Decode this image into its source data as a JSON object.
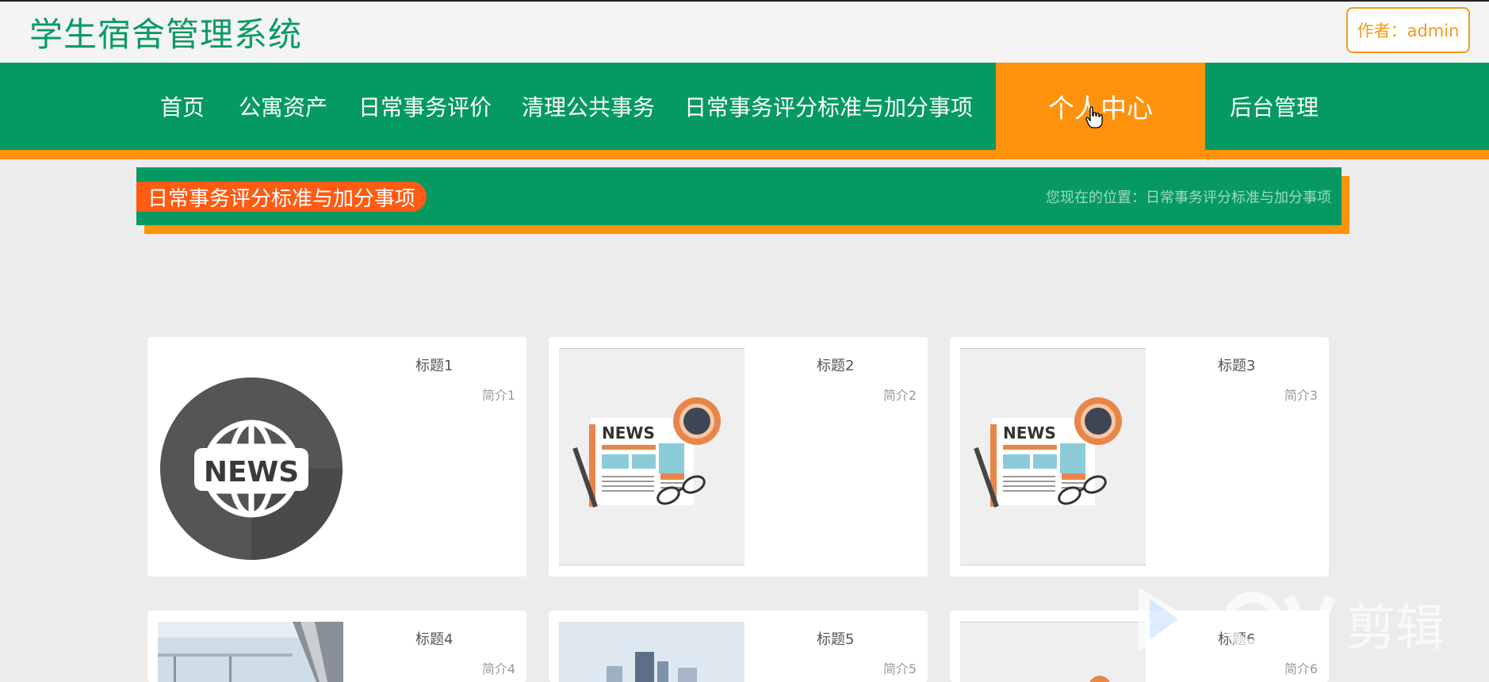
{
  "app": {
    "title": "学生宿舍管理系统",
    "author": "作者：admin"
  },
  "nav": {
    "items": [
      {
        "label": "首页"
      },
      {
        "label": "公寓资产"
      },
      {
        "label": "日常事务评价"
      },
      {
        "label": "清理公共事务"
      },
      {
        "label": "日常事务评分标准与加分事项"
      },
      {
        "label": "个人中心",
        "active": true
      },
      {
        "label": "后台管理"
      }
    ]
  },
  "breadcrumb": {
    "section_title": "日常事务评分标准与加分事项",
    "location": "您现在的位置：日常事务评分标准与加分事项"
  },
  "cards": [
    {
      "title": "标题1",
      "desc": "简介1",
      "image": "news-globe-icon"
    },
    {
      "title": "标题2",
      "desc": "简介2",
      "image": "newspaper-illustration"
    },
    {
      "title": "标题3",
      "desc": "简介3",
      "image": "newspaper-illustration"
    },
    {
      "title": "标题4",
      "desc": "简介4",
      "image": "building-photo"
    },
    {
      "title": "标题5",
      "desc": "简介5",
      "image": "city-photo"
    },
    {
      "title": "标题6",
      "desc": "简介6",
      "image": "orange-illustration"
    }
  ],
  "watermark": {
    "text": "剪辑"
  },
  "colors": {
    "green": "#069a62",
    "orange": "#ff920c",
    "red_orange": "#ff5b12",
    "title_green": "#0a9a63"
  }
}
